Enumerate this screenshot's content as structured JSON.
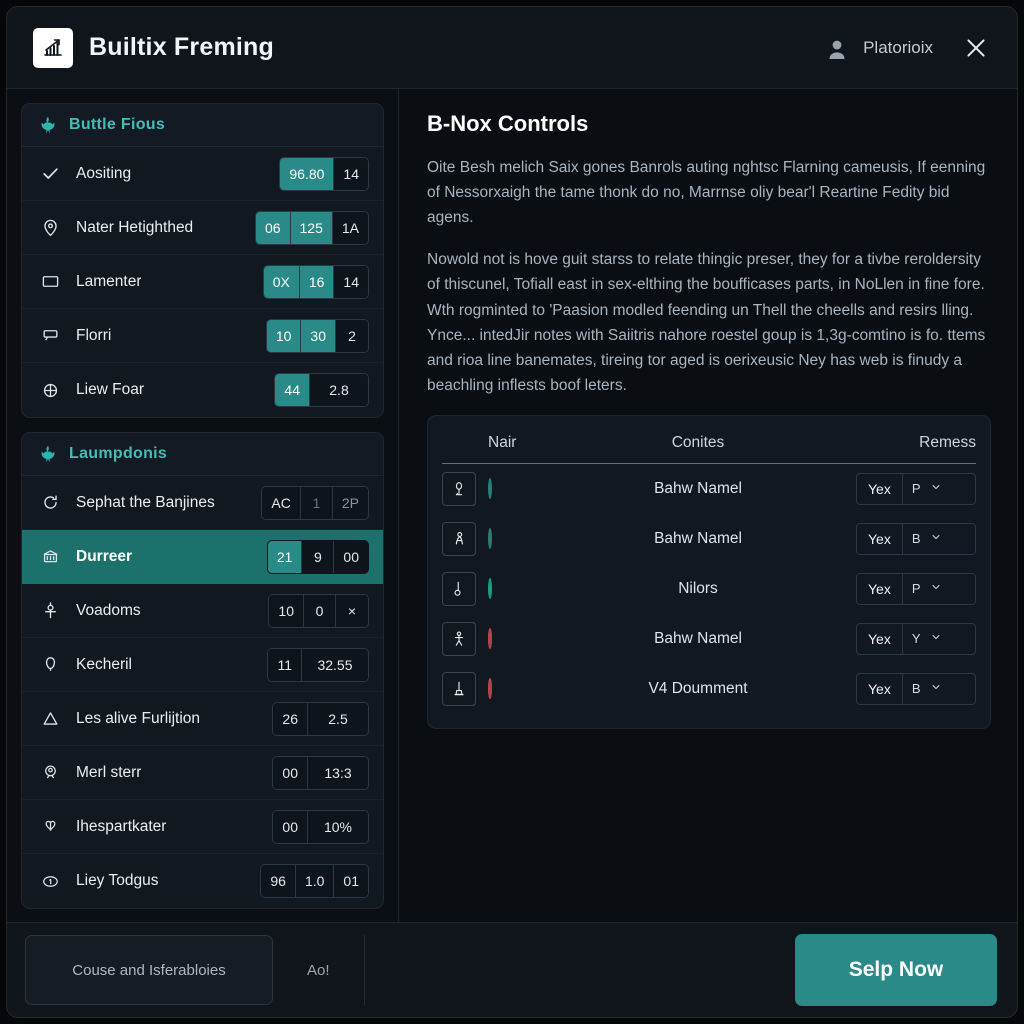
{
  "header": {
    "logo_icon": "bar-chart-growth-icon",
    "title": "Builtix Freming",
    "user_icon": "user-avatar-icon",
    "user_name": "Platorioix",
    "close_icon": "close-icon"
  },
  "sidebar": {
    "sections": [
      {
        "icon": "flame-icon",
        "label": "Buttle Fious",
        "items": [
          {
            "icon": "check-icon",
            "label": "Aositing",
            "chips": [
              {
                "text": "96.80",
                "on": true
              },
              {
                "text": "14",
                "on": false
              }
            ]
          },
          {
            "icon": "map-pin-icon",
            "label": "Nater Hetighthed",
            "chips": [
              {
                "text": "06",
                "on": true
              },
              {
                "text": "125",
                "on": true
              },
              {
                "text": "1A",
                "on": false
              }
            ]
          },
          {
            "icon": "monitor-icon",
            "label": "Lamenter",
            "chips": [
              {
                "text": "0X",
                "on": true
              },
              {
                "text": "16",
                "on": true
              },
              {
                "text": "14",
                "on": false
              }
            ]
          },
          {
            "icon": "chat-icon",
            "label": "Florri",
            "chips": [
              {
                "text": "10",
                "on": true
              },
              {
                "text": "30",
                "on": true
              },
              {
                "text": "2",
                "on": false
              }
            ]
          },
          {
            "icon": "globe-icon",
            "label": "Liew Foar",
            "chips": [
              {
                "text": "44",
                "on": true
              },
              {
                "text": "2.8",
                "on": false
              }
            ]
          }
        ]
      },
      {
        "icon": "flame-icon",
        "label": "Laumpdonis",
        "items": [
          {
            "icon": "refresh-icon",
            "label": "Sephat the Banjines",
            "selected": false,
            "chips": [
              {
                "text": "AC",
                "on": false
              },
              {
                "text": "1",
                "on": false
              },
              {
                "text": "2P",
                "on": false
              }
            ]
          },
          {
            "icon": "bank-icon",
            "label": "Durreer",
            "selected": true,
            "chips": [
              {
                "text": "21",
                "on": true
              },
              {
                "text": "9",
                "on": false
              },
              {
                "text": "00",
                "on": false
              }
            ]
          },
          {
            "icon": "anchor-icon",
            "label": "Voadoms",
            "selected": false,
            "chips": [
              {
                "text": "10",
                "on": false
              },
              {
                "text": "0",
                "on": false
              },
              {
                "text": "×",
                "on": false
              }
            ]
          },
          {
            "icon": "balloon-icon",
            "label": "Kecheril",
            "selected": false,
            "chips": [
              {
                "text": "11",
                "on": false
              },
              {
                "text": "32.55",
                "on": false
              }
            ]
          },
          {
            "icon": "triangle-icon",
            "label": "Les alive Furlijtion",
            "selected": false,
            "chips": [
              {
                "text": "26",
                "on": false
              },
              {
                "text": "2.5",
                "on": false
              }
            ]
          },
          {
            "icon": "person-badge-icon",
            "label": "Merl sterr",
            "selected": false,
            "chips": [
              {
                "text": "00",
                "on": false
              },
              {
                "text": "13:3",
                "on": false
              }
            ]
          },
          {
            "icon": "heart-split-icon",
            "label": "Ihespartkater",
            "selected": false,
            "chips": [
              {
                "text": "00",
                "on": false
              },
              {
                "text": "10%",
                "on": false
              }
            ]
          },
          {
            "icon": "number-one-icon",
            "label": "Liey Todgus",
            "selected": false,
            "chips": [
              {
                "text": "96",
                "on": false
              },
              {
                "text": "1.0",
                "on": false
              },
              {
                "text": "01",
                "on": false
              }
            ]
          }
        ]
      }
    ]
  },
  "main": {
    "heading": "B-Nox Controls",
    "paragraphs": [
      "Oite Besh melich Saix gones Banrols auting nghtsc Flarning cameusis, If eenning of Nessorxaigh the tame thonk do no, Marrnse oliy bear'l Reartine Fedity bid agens.",
      "Nowold not is hove guit starss to relate thingic preser, they for a tivbe reroldersity of thiscunel, Tofiall east in sex-elthing the boufficases parts, in NoLlen in fine fore. Wth rogminted to 'Paasion modled feending un Thell the cheells and resirs lling. Ynce... intedJir notes with Saiitris nahore roestel goup is 1,3g-comtino is fo. ttems and rioa line banemates, tireing tor aged is oerixeusic Ney has web is finudy a beachling inflests boof leters."
    ],
    "table": {
      "columns": [
        "Nair",
        "Conites",
        "Remess"
      ],
      "rows": [
        {
          "icon": "figure-kneel-icon",
          "status": "teal",
          "name": "Bahw Namel",
          "control_text": "Yex",
          "control_value": "P"
        },
        {
          "icon": "figure-lean-icon",
          "status": "teal",
          "name": "Bahw Namel",
          "control_text": "Yex",
          "control_value": "B"
        },
        {
          "icon": "figure-bend-icon",
          "status": "green",
          "name": "Nilors",
          "control_text": "Yex",
          "control_value": "P"
        },
        {
          "icon": "figure-stand-icon",
          "status": "red",
          "name": "Bahw Namel",
          "control_text": "Yex",
          "control_value": "Y"
        },
        {
          "icon": "figure-monument-icon",
          "status": "red",
          "name": "V4 Doumment",
          "control_text": "Yex",
          "control_value": "B"
        }
      ]
    }
  },
  "footer": {
    "secondary_button": "Couse and Isferabloies",
    "link": "Ao!",
    "primary_button": "Selp Now"
  },
  "colors": {
    "accent": "#2a8a87",
    "accent_text": "#45bdb6",
    "selected_row": "#1d716d",
    "status_red": "#d96a72",
    "status_green": "#17a07f"
  }
}
